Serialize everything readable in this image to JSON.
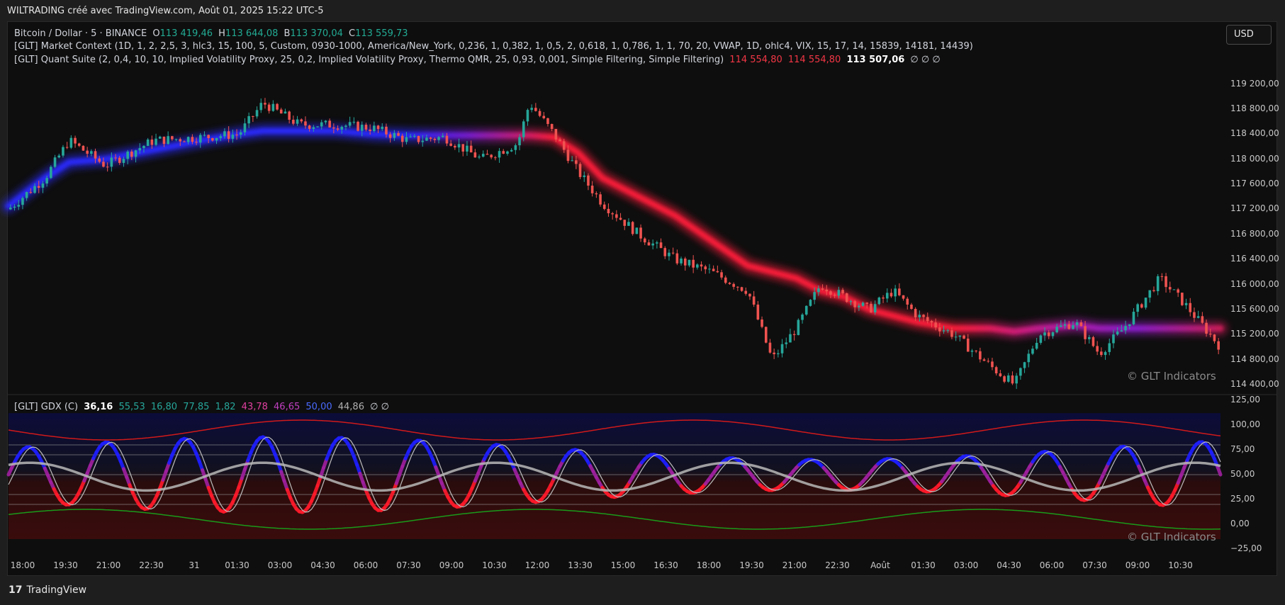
{
  "header": {
    "title": "WILTRADING créé avec TradingView.com, Août 01, 2025 15:22 UTC-5"
  },
  "currency_button": "USD",
  "legend_main": {
    "symbol": "Bitcoin / Dollar · 5 · BINANCE",
    "o_label": "O",
    "o_value": "113 419,46",
    "h_label": "H",
    "h_value": "113 644,08",
    "b_label": "B",
    "b_value": "113 370,04",
    "c_label": "C",
    "c_value": "113 559,73"
  },
  "legend_market_context": "[GLT] Market Context (1D, 1, 2, 2,5, 3, hlc3, 15, 100, 5, Custom, 0930-1000, America/New_York, 0,236, 1, 0,382, 1, 0,5, 2, 0,618, 1, 0,786, 1, 1, 70, 20, VWAP, 1D, ohlc4, VIX, 15, 17, 14, 15839, 14181, 14439)",
  "legend_quant": {
    "text": "[GLT] Quant Suite (2, 0,4, 10, 10, Implied Volatility Proxy, 25, 0,2, Implied Volatility Proxy, Thermo QMR, 25, 0,93, 0,001, Simple Filtering, Simple Filtering)",
    "v1": "114 554,80",
    "v2": "114 554,80",
    "v3": "113 507,06",
    "v4": "∅ ∅ ∅"
  },
  "legend_gdx": {
    "name": "[GLT] GDX (C)",
    "v1": "36,16",
    "v2": "55,53",
    "v3": "16,80",
    "v4": "77,85",
    "v5": "1,82",
    "v6": "43,78",
    "v7": "46,65",
    "v8": "50,00",
    "v9": "44,86",
    "v10": "∅ ∅"
  },
  "watermark": "© GLT Indicators",
  "footer": {
    "brand": "TradingView",
    "logo": "17"
  },
  "price_axis": [
    "119 200,00",
    "118 800,00",
    "118 400,00",
    "118 000,00",
    "117 600,00",
    "117 200,00",
    "116 800,00",
    "116 400,00",
    "116 000,00",
    "115 600,00",
    "115 200,00",
    "114 800,00",
    "114 400,00"
  ],
  "osc_axis": [
    "125,00",
    "100,00",
    "75,00",
    "50,00",
    "25,00",
    "0,00",
    "−25,00"
  ],
  "time_axis": [
    "18:00",
    "19:30",
    "21:00",
    "22:30",
    "31",
    "01:30",
    "03:00",
    "04:30",
    "06:00",
    "07:30",
    "09:00",
    "10:30",
    "12:00",
    "13:30",
    "15:00",
    "16:30",
    "18:00",
    "19:30",
    "21:00",
    "22:30",
    "Août",
    "01:30",
    "03:00",
    "04:30",
    "06:00",
    "07:30",
    "09:00",
    "10:30"
  ],
  "colors": {
    "up": "#26a69a",
    "down": "#ef5350",
    "bull_band": "#2a2aff",
    "bear_band": "#ff1a3a",
    "osc_bull": "#1e1eff",
    "osc_bear": "#ff1a2a",
    "background": "#0e0e0e"
  },
  "chart_data": [
    {
      "type": "candlestick",
      "title": "Bitcoin / Dollar · 5 · BINANCE",
      "ylim": [
        114300,
        119500
      ],
      "x_range": [
        "18:00",
        "11:25"
      ],
      "price_path_x": [
        0,
        0.03,
        0.05,
        0.08,
        0.12,
        0.16,
        0.19,
        0.21,
        0.24,
        0.27,
        0.3,
        0.33,
        0.36,
        0.39,
        0.42,
        0.43,
        0.45,
        0.47,
        0.49,
        0.52,
        0.55,
        0.58,
        0.61,
        0.63,
        0.65,
        0.67,
        0.69,
        0.71,
        0.73,
        0.75,
        0.78,
        0.81,
        0.83,
        0.85,
        0.88,
        0.9,
        0.92,
        0.95,
        0.97,
        1.0
      ],
      "price_path_y": [
        117200,
        117700,
        118300,
        117900,
        118300,
        118350,
        118400,
        118900,
        118550,
        118550,
        118500,
        118300,
        118350,
        118000,
        118250,
        118900,
        118400,
        117800,
        117300,
        116800,
        116400,
        116200,
        115900,
        114800,
        115300,
        116000,
        115800,
        115600,
        115900,
        115500,
        115200,
        114700,
        114400,
        115200,
        115400,
        114900,
        115300,
        116100,
        115700,
        115000
      ],
      "band_y": [
        117250,
        117700,
        117950,
        118000,
        118150,
        118300,
        118400,
        118450,
        118450,
        118450,
        118400,
        118380,
        118380,
        118380,
        118380,
        118380,
        118350,
        118100,
        117700,
        117400,
        117100,
        116700,
        116300,
        116200,
        116100,
        115900,
        115800,
        115600,
        115500,
        115400,
        115300,
        115300,
        115250,
        115300,
        115350,
        115300,
        115300,
        115300,
        115300,
        115300
      ]
    },
    {
      "type": "line",
      "title": "[GLT] GDX (C)",
      "ylim": [
        -25,
        125
      ],
      "levels": [
        80,
        70,
        50,
        30,
        20
      ]
    }
  ]
}
